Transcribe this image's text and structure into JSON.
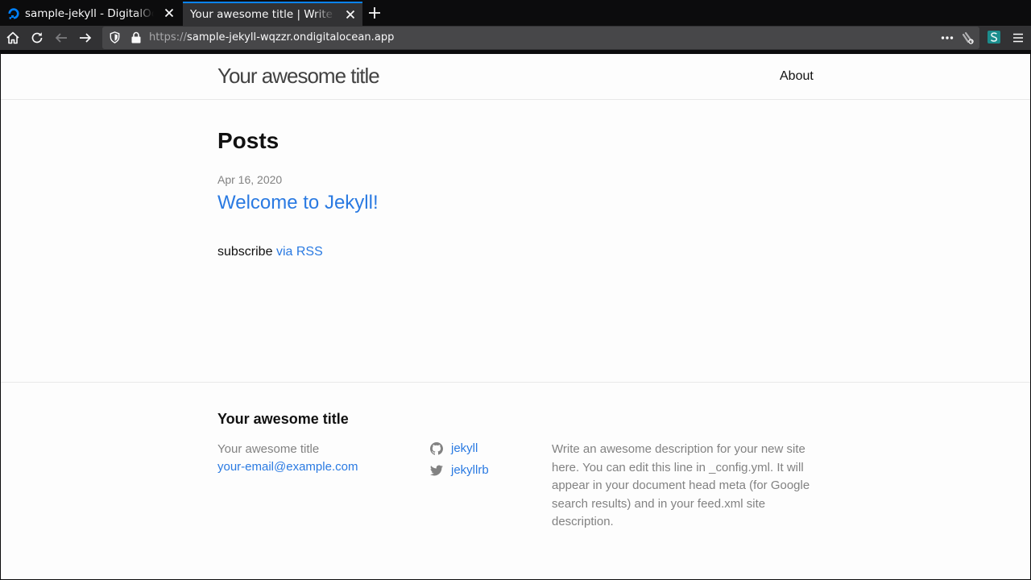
{
  "browser": {
    "tabs": [
      {
        "title": "sample-jekyll - DigitalOcean",
        "favicon": "digitalocean-icon",
        "active": false
      },
      {
        "title": "Your awesome title | Write an awesome description",
        "active": true
      }
    ],
    "url": {
      "protocol": "https://",
      "host": "sample-jekyll-wqzzr.ondigitalocean.app"
    },
    "colors": {
      "accent": "#0a84ff",
      "toolbar": "#323234",
      "tabstrip": "#0c0c0d"
    }
  },
  "page": {
    "site_title": "Your awesome title",
    "nav": {
      "about": "About"
    },
    "posts_heading": "Posts",
    "posts": [
      {
        "date": "Apr 16, 2020",
        "title": "Welcome to Jekyll!"
      }
    ],
    "subscribe": {
      "prefix": "subscribe",
      "link": "via RSS"
    },
    "footer": {
      "heading": "Your awesome title",
      "name": "Your awesome title",
      "email": "your-email@example.com",
      "social": [
        {
          "icon": "github-icon",
          "label": "jekyll"
        },
        {
          "icon": "twitter-icon",
          "label": "jekyllrb"
        }
      ],
      "description": "Write an awesome description for your new site here. You can edit this line in _config.yml. It will appear in your document head meta (for Google search results) and in your feed.xml site description."
    },
    "colors": {
      "link": "#2a7ae2",
      "muted": "#828282",
      "text": "#111111"
    }
  }
}
